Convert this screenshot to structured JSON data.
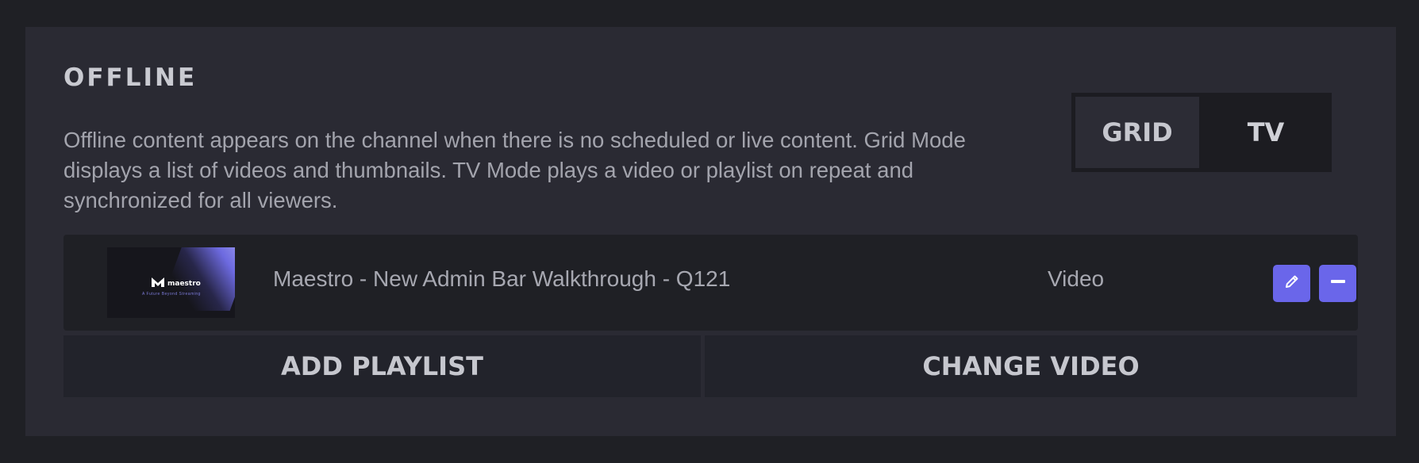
{
  "section": {
    "title": "OFFLINE",
    "description": "Offline content appears on the channel when there is no scheduled or live content. Grid Mode displays a list of videos and thumbnails. TV Mode plays a video or playlist on repeat and synchronized for all viewers."
  },
  "mode_toggle": {
    "options": [
      {
        "label": "GRID",
        "active": true
      },
      {
        "label": "TV",
        "active": false
      }
    ]
  },
  "content_item": {
    "thumbnail": {
      "logo_text": "maestro",
      "caption": "A Future Beyond Streaming"
    },
    "title": "Maestro - New Admin Bar Walkthrough - Q121",
    "type": "Video",
    "actions": {
      "edit_icon": "pencil-icon",
      "remove_icon": "minus-icon"
    }
  },
  "buttons": {
    "add_playlist": "ADD PLAYLIST",
    "change_video": "CHANGE VIDEO"
  },
  "colors": {
    "background": "#1f2025",
    "panel": "#2a2a33",
    "accent": "#6a66ea",
    "text_primary": "#c9cad1",
    "text_secondary": "#a3a4ad"
  }
}
